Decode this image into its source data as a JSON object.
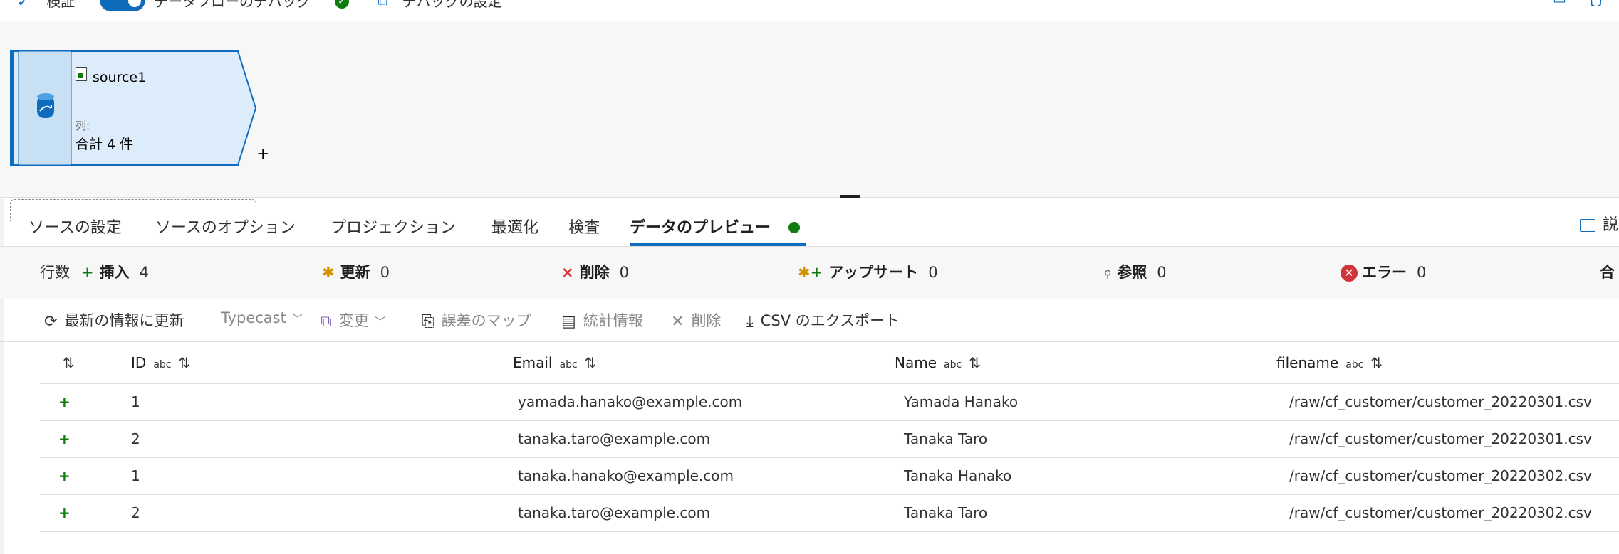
{
  "topbar": {
    "validate_label": "検証",
    "debug_label": "データフローのデバッグ",
    "debug_settings_label": "デバッグの設定"
  },
  "node": {
    "name": "source1",
    "columns_label": "列:",
    "columns_count": "合計 4 件",
    "add_label": "+"
  },
  "tabs": [
    {
      "label": "ソースの設定"
    },
    {
      "label": "ソースのオプション"
    },
    {
      "label": "プロジェクション"
    },
    {
      "label": "最適化"
    },
    {
      "label": "検査"
    },
    {
      "label": "データのプレビュー"
    }
  ],
  "tab_right_label": "説",
  "stats": {
    "rowcount_label": "行数",
    "insert": {
      "label": "挿入",
      "value": "4"
    },
    "update": {
      "label": "更新",
      "value": "0"
    },
    "delete": {
      "label": "削除",
      "value": "0"
    },
    "upsert": {
      "label": "アップサート",
      "value": "0"
    },
    "lookup": {
      "label": "参照",
      "value": "0"
    },
    "error": {
      "label": "エラー",
      "value": "0"
    },
    "total_label": "合"
  },
  "actions": {
    "refresh": "最新の情報に更新",
    "typecast": "Typecast",
    "modify": "変更",
    "map_drifted": "誤差のマップ",
    "statistics": "統計情報",
    "remove": "削除",
    "export_csv": "CSV のエクスポート"
  },
  "grid": {
    "columns": [
      {
        "name": "ID",
        "type": "abc"
      },
      {
        "name": "Email",
        "type": "abc"
      },
      {
        "name": "Name",
        "type": "abc"
      },
      {
        "name": "filename",
        "type": "abc"
      }
    ],
    "rows": [
      {
        "id": "1",
        "email": "yamada.hanako@example.com",
        "name": "Yamada Hanako",
        "filename": "/raw/cf_customer/customer_20220301.csv"
      },
      {
        "id": "2",
        "email": "tanaka.taro@example.com",
        "name": "Tanaka Taro",
        "filename": "/raw/cf_customer/customer_20220301.csv"
      },
      {
        "id": "1",
        "email": "tanaka.hanako@example.com",
        "name": "Tanaka Hanako",
        "filename": "/raw/cf_customer/customer_20220302.csv"
      },
      {
        "id": "2",
        "email": "tanaka.taro@example.com",
        "name": "Tanaka Taro",
        "filename": "/raw/cf_customer/customer_20220302.csv"
      }
    ]
  },
  "colors": {
    "accent": "#0f6cbd",
    "success": "#107c10",
    "error": "#d13438",
    "warning": "#d29200",
    "node_fill": "#dcecfb"
  }
}
